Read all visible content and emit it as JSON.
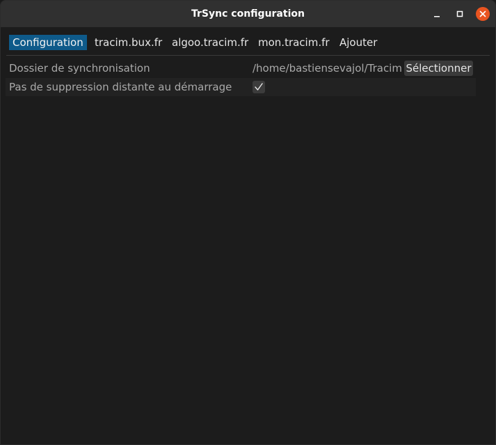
{
  "window": {
    "title": "TrSync configuration"
  },
  "tabs": [
    {
      "label": "Configuration",
      "active": true
    },
    {
      "label": "tracim.bux.fr",
      "active": false
    },
    {
      "label": "algoo.tracim.fr",
      "active": false
    },
    {
      "label": "mon.tracim.fr",
      "active": false
    },
    {
      "label": "Ajouter",
      "active": false
    }
  ],
  "settings": {
    "sync_folder": {
      "label": "Dossier de synchronisation",
      "value": "/home/bastiensevajol/Tracim",
      "button_label": "Sélectionner"
    },
    "no_remote_delete": {
      "label": "Pas de suppression distante au démarrage",
      "checked": true
    }
  },
  "icons": {
    "minimize": "minimize-icon",
    "maximize": "maximize-icon",
    "close": "close-icon",
    "check": "check-icon"
  },
  "colors": {
    "accent": "#0e5a8a",
    "close_button": "#e95420",
    "titlebar": "#303030",
    "background": "#1c1c1c"
  }
}
